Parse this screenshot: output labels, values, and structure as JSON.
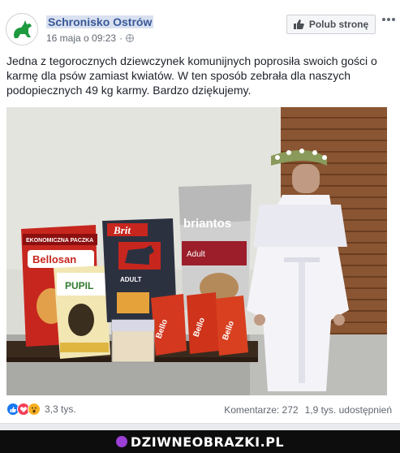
{
  "post": {
    "page_name": "Schronisko Ostrów",
    "timestamp": "16 maja o 09:23",
    "separator": "·",
    "like_page_label": "Polub stronę",
    "text": "Jedna z tegorocznych dziewczynek komunijnych poprosiła swoich gości o karmę dla psów zamiast kwiatów. W ten sposób zebrała dla naszych podopiecznych 49 kg karmy. Bardzo dziękujemy."
  },
  "photo": {
    "bags": {
      "bellosan_banner": "EKONOMICZNA PACZKA",
      "bellosan": "Bellosan",
      "pupil": "PUPIL",
      "brit": "Brit",
      "brit_adult": "ADULT",
      "briantos": "briantos",
      "briantos_adult": "Adult",
      "small_bag": "Bello"
    }
  },
  "footer": {
    "reaction_count": "3,3 tys.",
    "comments": "Komentarze: 272",
    "shares": "1,9 tys. udostępnień"
  },
  "watermark": {
    "text": "DZIWNEOBRAZKI.PL"
  },
  "colors": {
    "link": "#385898",
    "like": "#1877f2",
    "love": "#f33e58",
    "wow": "#f7b125",
    "brand_green": "#1d9a3e"
  }
}
